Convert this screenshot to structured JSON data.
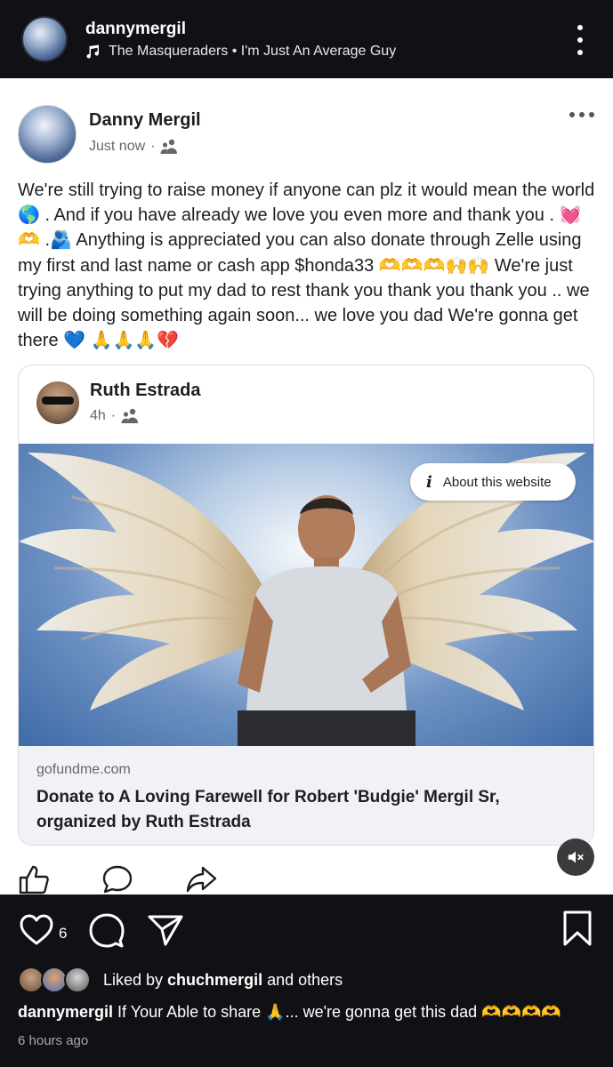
{
  "instagram": {
    "username": "dannymergil",
    "music": "The Masqueraders • I'm Just An Average Guy",
    "like_count": "6",
    "liked_by_prefix": "Liked by ",
    "liked_by_user": "chuchmergil",
    "liked_by_suffix": " and others",
    "caption_user": "dannymergil",
    "caption_text": " If Your Able to share 🙏... we're gonna get this dad 🫶🫶🫶🫶",
    "time_ago": "6 hours ago",
    "icons": [
      "music-note-icon",
      "more-vertical-icon",
      "heart-icon",
      "comment-icon",
      "share-icon",
      "bookmark-icon"
    ]
  },
  "facebook_post": {
    "author": "Danny Mergil",
    "time": "Just now",
    "dot": "·",
    "audience_icon": "friends-icon",
    "text": "We're still trying to raise money if anyone can plz it would mean the world 🌎 . And if you have already we love you even more and thank you . 💓🫶 .🫂 Anything is appreciated you can also donate through Zelle using my first and last name or cash app $honda33 🫶🫶🫶🙌🙌 We're just trying anything to put my dad to rest thank you thank you thank you .. we will be doing something again soon... we love you dad We're gonna get there 💙 🙏🙏🙏💔",
    "shared": {
      "author": "Ruth Estrada",
      "time": "4h",
      "dot": "·",
      "about_label": "About this website",
      "domain": "gofundme.com",
      "title": "Donate to A Loving Farewell for Robert 'Budgie' Mergil Sr, organized by Ruth Estrada"
    },
    "actions": [
      "like-icon",
      "comment-icon",
      "share-icon"
    ],
    "mute_icon": "mute-icon"
  },
  "colors": {
    "background": "#0f1114",
    "card": "#ffffff",
    "link_footer": "#f0f2f5",
    "secondary_text": "#65676b"
  }
}
